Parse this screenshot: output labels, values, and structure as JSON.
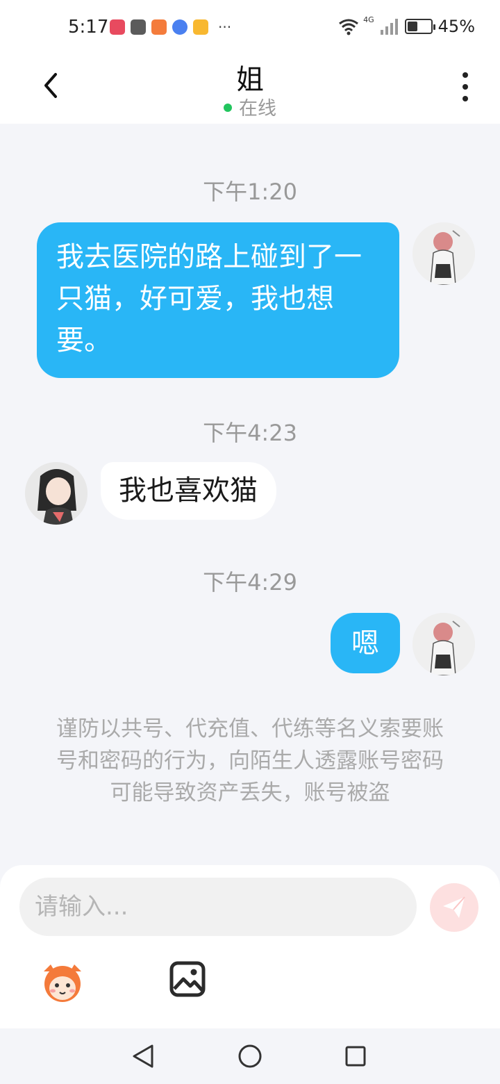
{
  "status_bar": {
    "time": "5:17",
    "network": "4G",
    "battery": "45%",
    "battery_fraction": 0.45,
    "app_icons": [
      "books-app-icon",
      "huawei-app-icon",
      "video-app-icon",
      "music-app-icon",
      "notes-app-icon"
    ],
    "more": "···"
  },
  "header": {
    "title": "姐",
    "status": "在线",
    "status_color": "#22c55e"
  },
  "messages": [
    {
      "time": "下午1:20",
      "direction": "outgoing",
      "text": "我去医院的路上碰到了一只猫，好可爱，我也想要。"
    },
    {
      "time": "下午4:23",
      "direction": "incoming",
      "text": "我也喜欢猫"
    },
    {
      "time": "下午4:29",
      "direction": "outgoing",
      "text": "嗯"
    }
  ],
  "notice": "谨防以共号、代充值、代练等名义索要账号和密码的行为，向陌生人透露账号密码可能导致资产丢失，账号被盗",
  "input": {
    "placeholder": "请输入..."
  },
  "colors": {
    "outgoing_bubble": "#29b6f6",
    "incoming_bubble": "#ffffff",
    "background": "#f4f5f9",
    "send_button": "#fde0e0"
  }
}
